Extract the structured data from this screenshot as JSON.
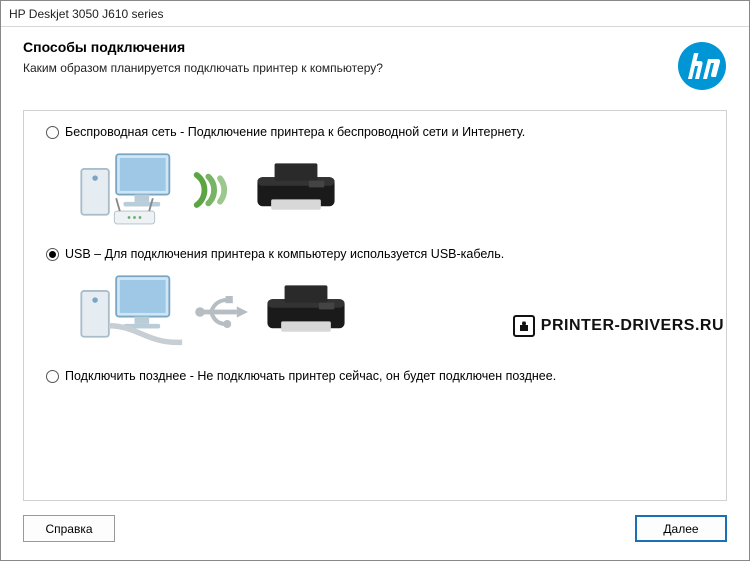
{
  "window": {
    "title": "HP Deskjet 3050 J610 series"
  },
  "header": {
    "title": "Способы подключения",
    "subtitle": "Каким образом планируется подключать принтер к компьютеру?"
  },
  "options": {
    "wireless": {
      "label": "Беспроводная сеть - Подключение принтера к беспроводной сети и Интернету.",
      "selected": false
    },
    "usb": {
      "label": "USB – Для подключения принтера к компьютеру используется USB-кабель.",
      "selected": true
    },
    "later": {
      "label": "Подключить позднее - Не подключать принтер сейчас, он будет подключен  позднее.",
      "selected": false
    }
  },
  "watermark": {
    "text": "PRINTER-DRIVERS.RU"
  },
  "footer": {
    "help": "Справка",
    "next": "Далее"
  },
  "icons": {
    "hp_logo": "hp-logo",
    "computer": "computer-icon",
    "router": "router-icon",
    "wifi": "wifi-waves-icon",
    "printer": "printer-icon",
    "usb": "usb-icon"
  }
}
